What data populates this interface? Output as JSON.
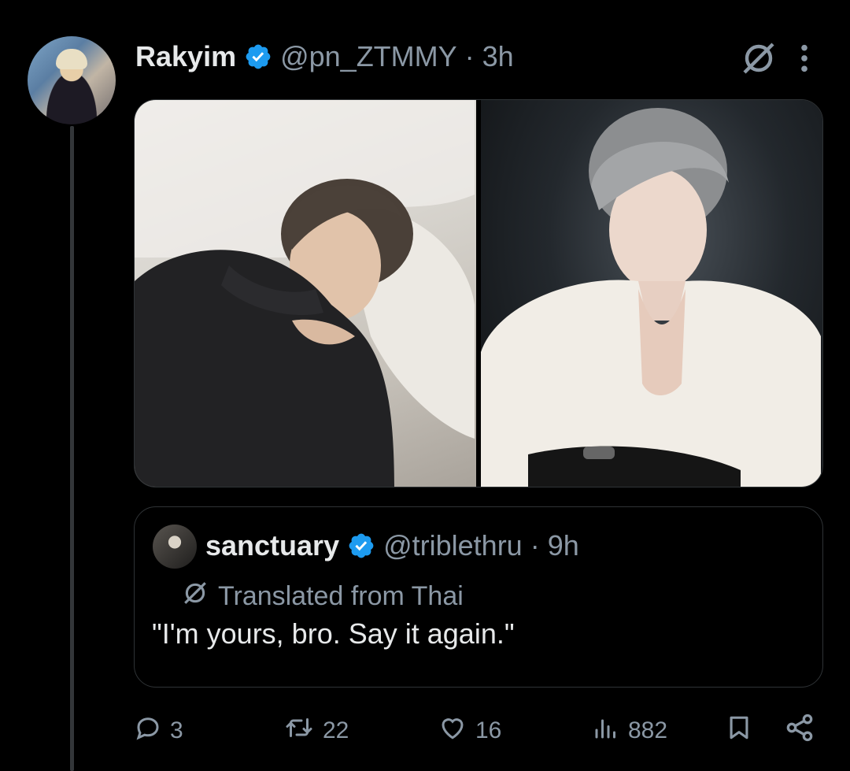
{
  "post": {
    "author_name": "Rakyim",
    "handle": "@pn_ZTMMY",
    "separator": "·",
    "time": "3h",
    "verified": true
  },
  "media": {
    "count": 2,
    "items": [
      "photo",
      "photo"
    ]
  },
  "quote": {
    "author_name": "sanctuary",
    "handle": "@triblethru",
    "separator": "·",
    "time": "9h",
    "verified": true,
    "translated_label": "Translated from Thai",
    "text": "\"I'm yours, bro. Say it again.\""
  },
  "stats": {
    "replies": "3",
    "reposts": "22",
    "likes": "16",
    "views": "882"
  },
  "colors": {
    "background": "#000000",
    "text_primary": "#e7e9ea",
    "text_secondary": "#8b98a5",
    "verified_blue": "#1d9bf0",
    "border": "#2f3336"
  },
  "icons": [
    "verified-icon",
    "grok-icon",
    "more-icon",
    "translate-icon",
    "reply-icon",
    "repost-icon",
    "like-icon",
    "views-icon",
    "bookmark-icon",
    "share-icon"
  ]
}
